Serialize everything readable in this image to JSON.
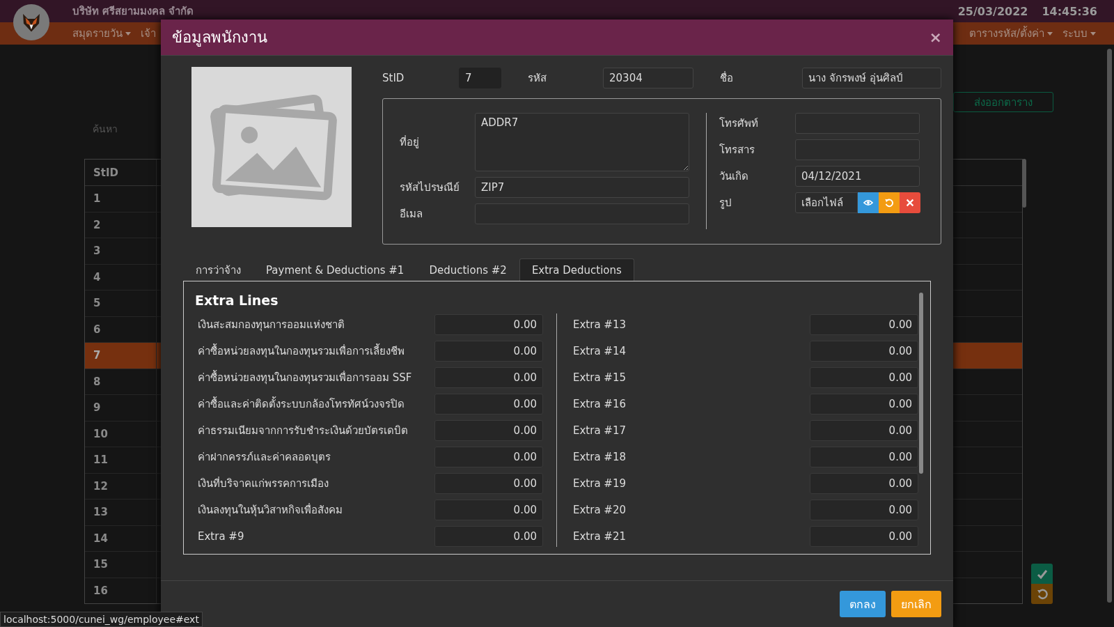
{
  "app_bar": {
    "company": "บริษัท ศรีสยามมงคล จำกัด",
    "date": "25/03/2022",
    "time": "14:45:36"
  },
  "nav_menu": [
    {
      "label": "สมุดรายวัน",
      "dropdown": true
    },
    {
      "label": "เจ้า",
      "dropdown": false
    },
    {
      "label": "ตารางรหัส/ตั้งค่า",
      "dropdown": true
    },
    {
      "label": "ระบบ",
      "dropdown": true
    }
  ],
  "search": {
    "placeholder": "ค้นหา"
  },
  "export_button": "ส่งออกตาราง",
  "table": {
    "columns": [
      "StID"
    ],
    "rows": [
      {
        "stid": "1",
        "selected": false
      },
      {
        "stid": "2",
        "selected": false
      },
      {
        "stid": "3",
        "selected": false
      },
      {
        "stid": "4",
        "selected": false
      },
      {
        "stid": "5",
        "selected": false
      },
      {
        "stid": "6",
        "selected": false
      },
      {
        "stid": "7",
        "selected": true
      },
      {
        "stid": "8",
        "selected": false
      },
      {
        "stid": "9",
        "selected": false
      },
      {
        "stid": "10",
        "selected": false
      },
      {
        "stid": "11",
        "selected": false
      },
      {
        "stid": "12",
        "selected": false
      },
      {
        "stid": "13",
        "selected": false
      },
      {
        "stid": "14",
        "selected": false
      },
      {
        "stid": "15",
        "selected": false
      },
      {
        "stid": "16",
        "selected": false
      }
    ]
  },
  "status_url": "localhost:5000/cunei_wg/employee#ext",
  "modal": {
    "title": "ข้อมูลพนักงาน",
    "close": "×",
    "header_fields": [
      {
        "label": "StID",
        "value": "7",
        "disabled": true
      },
      {
        "label": "รหัส",
        "value": "20304",
        "disabled": false
      },
      {
        "label": "ชื่อ",
        "value": "นาง จักรพงษ์ อุ่นศิลป์",
        "disabled": false
      }
    ],
    "address": {
      "label": "ที่อยู่",
      "value": "ADDR7"
    },
    "zip": {
      "label": "รหัสไปรษณีย์",
      "value": "ZIP7"
    },
    "email": {
      "label": "อีเมล"
    },
    "phone": {
      "label": "โทรศัพท์"
    },
    "fax": {
      "label": "โทรสาร"
    },
    "birthdate": {
      "label": "วันเกิด",
      "value": "04/12/2021"
    },
    "photo": {
      "label": "รูป",
      "button": "เลือกไฟล์"
    },
    "tabs": [
      {
        "label": "การว่าจ้าง",
        "selected": false
      },
      {
        "label": "Payment & Deductions #1",
        "selected": false
      },
      {
        "label": "Deductions #2",
        "selected": false
      },
      {
        "label": "Extra Deductions",
        "selected": true
      }
    ],
    "section_title": "Extra Lines",
    "left_lines": [
      {
        "label": "เงินสะสมกองทุนการออมแห่งชาติ",
        "value": "0.00"
      },
      {
        "label": "ค่าซื้อหน่วยลงทุนในกองทุนรวมเพื่อการเลี้ยงชีพ",
        "value": "0.00"
      },
      {
        "label": "ค่าซื้อหน่วยลงทุนในกองทุนรวมเพื่อการออม SSF",
        "value": "0.00"
      },
      {
        "label": "ค่าซื้อและค่าติดตั้งระบบกล้องโทรทัศน์วงจรปิด",
        "value": "0.00"
      },
      {
        "label": "ค่าธรรมเนียมจากการรับชำระเงินด้วยบัตรเดบิต",
        "value": "0.00"
      },
      {
        "label": "ค่าฝากครรภ์และค่าคลอดบุตร",
        "value": "0.00"
      },
      {
        "label": "เงินที่บริจาคแก่พรรคการเมือง",
        "value": "0.00"
      },
      {
        "label": "เงินลงทุนในหุ้นวิสาหกิจเพื่อสังคม",
        "value": "0.00"
      },
      {
        "label": "Extra #9",
        "value": "0.00"
      }
    ],
    "right_lines": [
      {
        "label": "Extra #13",
        "value": "0.00"
      },
      {
        "label": "Extra #14",
        "value": "0.00"
      },
      {
        "label": "Extra #15",
        "value": "0.00"
      },
      {
        "label": "Extra #16",
        "value": "0.00"
      },
      {
        "label": "Extra #17",
        "value": "0.00"
      },
      {
        "label": "Extra #18",
        "value": "0.00"
      },
      {
        "label": "Extra #19",
        "value": "0.00"
      },
      {
        "label": "Extra #20",
        "value": "0.00"
      },
      {
        "label": "Extra #21",
        "value": "0.00"
      }
    ],
    "buttons": {
      "ok": "ตกลง",
      "cancel": "ยกเลิก"
    }
  }
}
